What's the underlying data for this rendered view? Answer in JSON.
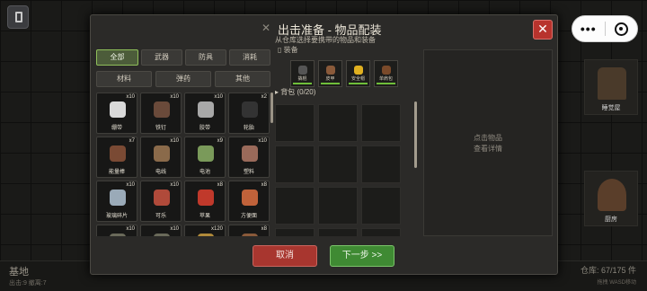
{
  "modal": {
    "title": "出击准备 - 物品配装",
    "subtitle": "从仓库选择要携带的物品和装备",
    "close_label": "✕"
  },
  "tabs": [
    {
      "label": "全部",
      "active": true
    },
    {
      "label": "武器",
      "active": false
    },
    {
      "label": "防具",
      "active": false
    },
    {
      "label": "消耗",
      "active": false
    },
    {
      "label": "材料",
      "active": false
    },
    {
      "label": "弹药",
      "active": false
    },
    {
      "label": "其他",
      "active": false
    }
  ],
  "items": [
    {
      "name": "绷带",
      "count": "x10",
      "icon": "bandage-icon",
      "color": "#d9d9d9"
    },
    {
      "name": "铁钉",
      "count": "x10",
      "icon": "nails-icon",
      "color": "#6a4a3a"
    },
    {
      "name": "胶带",
      "count": "x10",
      "icon": "tape-icon",
      "color": "#a8a8a8"
    },
    {
      "name": "轮胎",
      "count": "x2",
      "icon": "tire-icon",
      "color": "#333333"
    },
    {
      "name": "能量棒",
      "count": "x7",
      "icon": "energy-bar-icon",
      "color": "#7a4a34"
    },
    {
      "name": "电线",
      "count": "x10",
      "icon": "wire-icon",
      "color": "#8a6a4a"
    },
    {
      "name": "电池",
      "count": "x9",
      "icon": "battery-icon",
      "color": "#7a9a5a"
    },
    {
      "name": "塑料",
      "count": "x10",
      "icon": "plastic-icon",
      "color": "#9a6a5a"
    },
    {
      "name": "玻璃碎片",
      "count": "x10",
      "icon": "glass-shard-icon",
      "color": "#9aaab8"
    },
    {
      "name": "可乐",
      "count": "x10",
      "icon": "cola-icon",
      "color": "#b04a3a"
    },
    {
      "name": "苹果",
      "count": "x8",
      "icon": "apple-icon",
      "color": "#c0392b"
    },
    {
      "name": "方便面",
      "count": "x8",
      "icon": "noodles-icon",
      "color": "#c0623a"
    },
    {
      "name": "",
      "count": "x10",
      "icon": "item-icon",
      "color": "#6a6a5a"
    },
    {
      "name": "",
      "count": "x10",
      "icon": "item-icon",
      "color": "#6a6a5a"
    },
    {
      "name": "",
      "count": "x120",
      "icon": "ammo-icon",
      "color": "#b08a3a"
    },
    {
      "name": "",
      "count": "x8",
      "icon": "item-icon",
      "color": "#8a5a3a"
    }
  ],
  "equipment": {
    "title": "装备",
    "slots": [
      {
        "name": "撬棍",
        "icon": "crowbar-icon",
        "color": "#555555"
      },
      {
        "name": "皮甲",
        "icon": "leather-armor-icon",
        "color": "#8a5a3a"
      },
      {
        "name": "安全帽",
        "icon": "hardhat-icon",
        "color": "#e0b020"
      },
      {
        "name": "单肩包",
        "icon": "shoulder-bag-icon",
        "color": "#7a4a2a"
      }
    ]
  },
  "backpack": {
    "label": "背包 (0/20)"
  },
  "detail": {
    "line1": "点击物品",
    "line2": "查看详情"
  },
  "buttons": {
    "cancel": "取消",
    "next": "下一步 >>"
  },
  "background": {
    "base_label": "基地",
    "base_sub": "出击:9 撤离:7",
    "storage": "仓库: 67/175 件",
    "storage_sub": "拖拽 WASD移动",
    "buildings": [
      "睡觉屋",
      "厨房"
    ]
  },
  "mini_program": {
    "menu": "•••"
  }
}
